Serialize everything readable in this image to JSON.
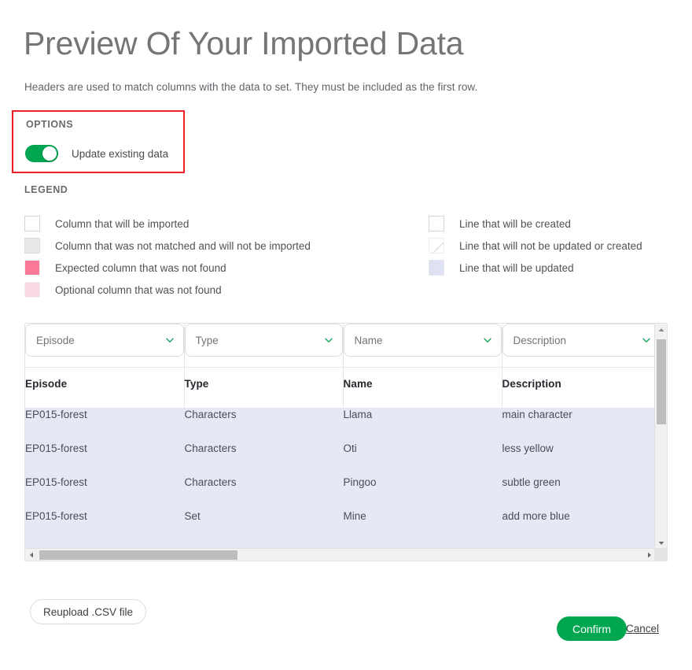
{
  "header": {
    "title": "Preview Of Your Imported Data",
    "subtitle": "Headers are used to match columns with the data to set. They must be included as the first row."
  },
  "options": {
    "section_label": "OPTIONS",
    "toggle_label": "Update existing data",
    "toggle_state": "on",
    "highlight_color": "#f01e21",
    "toggle_on_color": "#00a650"
  },
  "legend": {
    "section_label": "LEGEND",
    "left_items": [
      {
        "swatch": "white",
        "label": "Column that will be imported"
      },
      {
        "swatch": "gray",
        "label": "Column that was not matched and will not be imported"
      },
      {
        "swatch": "pink",
        "label": "Expected column that was not found"
      },
      {
        "swatch": "lightpink",
        "label": "Optional column that was not found"
      }
    ],
    "right_items": [
      {
        "swatch": "white",
        "label": "Line that will be created"
      },
      {
        "swatch": "striped",
        "label": "Line that will not be updated or created"
      },
      {
        "swatch": "lav",
        "label": "Line that will be updated"
      }
    ],
    "colors": {
      "white": "#ffffff",
      "gray": "#e9e9e9",
      "pink": "#fb7a99",
      "lightpink": "#fbd9e2",
      "lavender": "#dfe2f2"
    }
  },
  "table": {
    "selects": [
      "Episode",
      "Type",
      "Name",
      "Description"
    ],
    "headers": [
      "Episode",
      "Type",
      "Name",
      "Description"
    ],
    "rows": [
      [
        "EP015-forest",
        "Characters",
        "Llama",
        "main character"
      ],
      [
        "EP015-forest",
        "Characters",
        "Oti",
        "less yellow"
      ],
      [
        "EP015-forest",
        "Characters",
        "Pingoo",
        "subtle green"
      ],
      [
        "EP015-forest",
        "Set",
        "Mine",
        "add more blue"
      ]
    ],
    "row_highlight_color": "#e6e8f5"
  },
  "footer": {
    "reupload_label": "Reupload .CSV file",
    "confirm_label": "Confirm",
    "cancel_label": "Cancel",
    "confirm_color": "#00a650"
  }
}
